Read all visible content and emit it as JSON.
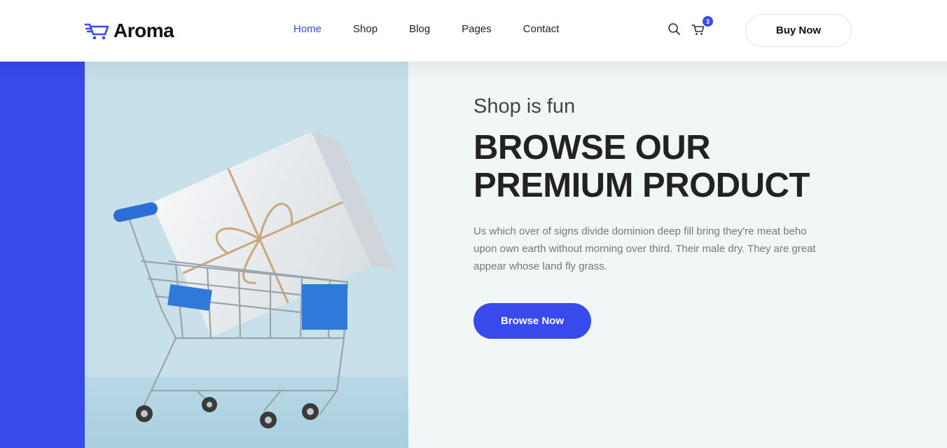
{
  "brand": {
    "name": "Aroma",
    "icon": "shopping-cart-logo-icon",
    "accent": "#384aeb"
  },
  "nav": {
    "items": [
      {
        "label": "Home",
        "active": true
      },
      {
        "label": "Shop",
        "active": false
      },
      {
        "label": "Blog",
        "active": false
      },
      {
        "label": "Pages",
        "active": false
      },
      {
        "label": "Contact",
        "active": false
      }
    ]
  },
  "header_actions": {
    "search_icon": "search-icon",
    "cart_icon": "shopping-cart-icon",
    "cart_count": "3",
    "buy_label": "Buy Now"
  },
  "hero": {
    "subtitle": "Shop is fun",
    "title_line1": "BROWSE OUR",
    "title_line2": "PREMIUM PRODUCT",
    "description": "Us which over of signs divide dominion deep fill bring they're meat beho upon own earth without morning over third. Their male dry. They are great appear whose land fly grass.",
    "cta_label": "Browse Now",
    "image": "shopping-cart-with-gift-box",
    "colors": {
      "strip": "#384aeb",
      "panel": "#f1f6f7",
      "image_bg": "#c7e0ea"
    }
  }
}
